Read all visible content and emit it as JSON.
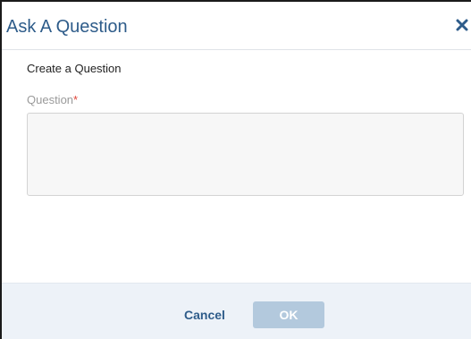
{
  "dialog": {
    "title": "Ask A Question",
    "close_icon": "close-icon",
    "subtitle": "Create a Question",
    "question_field": {
      "label": "Question",
      "required_marker": "*",
      "value": "",
      "placeholder": ""
    },
    "footer": {
      "cancel_label": "Cancel",
      "ok_label": "OK",
      "ok_state": "disabled"
    }
  },
  "colors": {
    "title": "#2e5c8a",
    "footer_bg": "#edf2f8",
    "ok_disabled_bg": "#b3c9dd",
    "required": "#e0463a"
  }
}
